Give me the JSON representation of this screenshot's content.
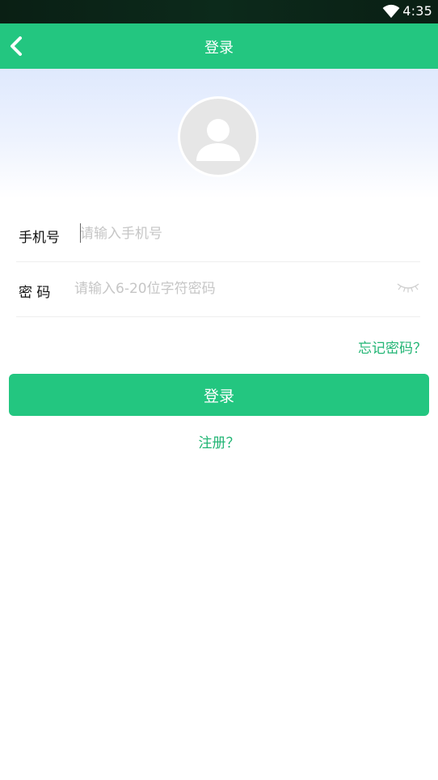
{
  "status_bar": {
    "time": "4:35",
    "icons": [
      "wifi-icon"
    ]
  },
  "app_bar": {
    "title": "登录",
    "back_icon": "chevron-left-icon"
  },
  "avatar": {
    "icon": "user-placeholder-icon"
  },
  "form": {
    "phone_label": "手机号",
    "phone_placeholder": "请输入手机号",
    "phone_value": "",
    "password_label": "密 码",
    "password_placeholder": "请输入6-20位字符密码",
    "password_value": "",
    "password_toggle_icon": "eye-closed-icon"
  },
  "links": {
    "forgot_password": "忘记密码？",
    "register": "注册？"
  },
  "buttons": {
    "login": "登录"
  },
  "colors": {
    "primary": "#23c680",
    "link": "#22b574",
    "status_bar": "#0c2a1b"
  }
}
